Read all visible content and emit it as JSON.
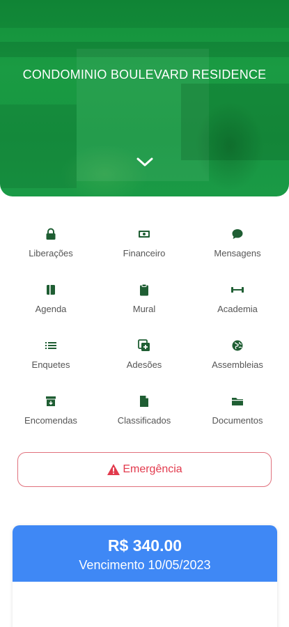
{
  "header": {
    "title": "CONDOMINIO BOULEVARD RESIDENCE",
    "bg_color": "#179641"
  },
  "menu": [
    {
      "label": "Liberações",
      "icon": "lock-icon"
    },
    {
      "label": "Financeiro",
      "icon": "money-icon"
    },
    {
      "label": "Mensagens",
      "icon": "chat-icon"
    },
    {
      "label": "Agenda",
      "icon": "book-icon"
    },
    {
      "label": "Mural",
      "icon": "clipboard-icon"
    },
    {
      "label": "Academia",
      "icon": "dumbbell-icon"
    },
    {
      "label": "Enquetes",
      "icon": "list-icon"
    },
    {
      "label": "Adesões",
      "icon": "add-copy-icon"
    },
    {
      "label": "Assembleias",
      "icon": "globe-icon"
    },
    {
      "label": "Encomendas",
      "icon": "archive-box-icon"
    },
    {
      "label": "Classificados",
      "icon": "document-icon"
    },
    {
      "label": "Documentos",
      "icon": "folder-icon"
    }
  ],
  "emergency": {
    "label": "Emergência",
    "color": "#e23a4d"
  },
  "bill": {
    "amount": "R$ 340.00",
    "due": "Vencimento 10/05/2023",
    "color": "#3f88f5"
  },
  "colors": {
    "icon": "#1f5e33",
    "label": "#555555"
  }
}
